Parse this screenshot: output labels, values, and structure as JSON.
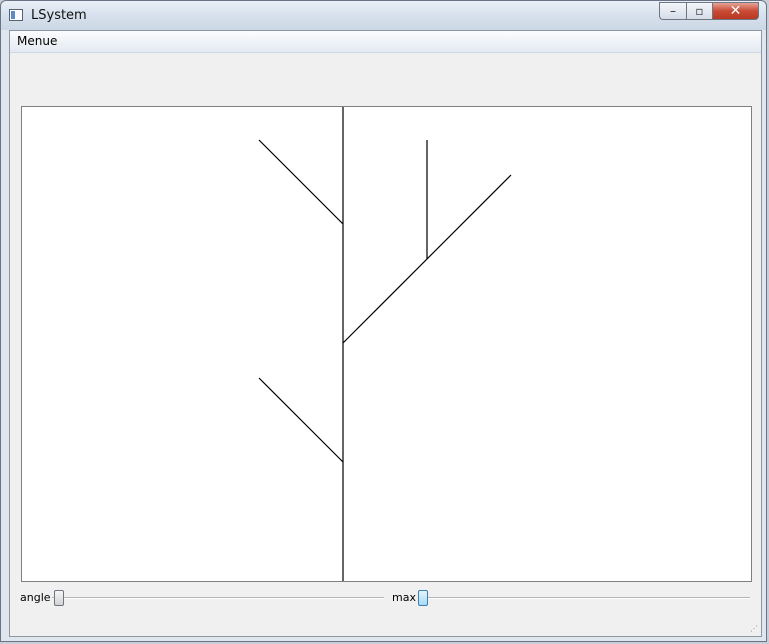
{
  "window": {
    "title": "LSystem",
    "icon": "application-window-icon",
    "buttons": {
      "minimize": "–",
      "maximize": "▫",
      "close": "✕"
    }
  },
  "menubar": {
    "items": [
      "Menue"
    ]
  },
  "canvas": {
    "description_color": "#000000",
    "background": "#ffffff"
  },
  "controls": {
    "angle": {
      "label": "angle"
    },
    "max": {
      "label": "max"
    }
  }
}
